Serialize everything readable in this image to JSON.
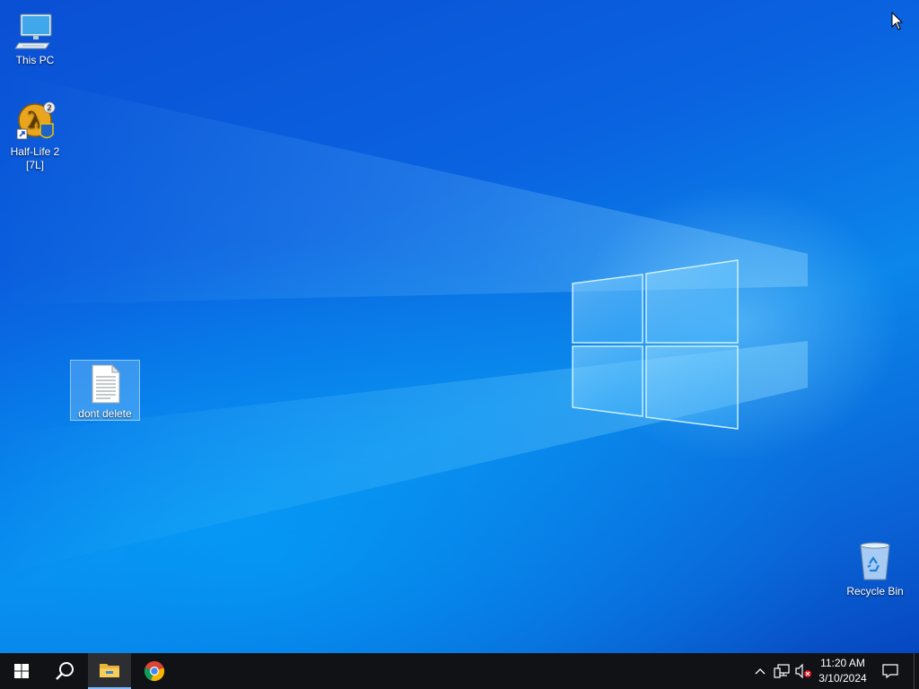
{
  "desktop": {
    "icons": [
      {
        "label": "This PC",
        "icon": "this-pc-icon"
      },
      {
        "label": "Half-Life 2\n[7L]",
        "icon": "half-life-2-shortcut-icon"
      },
      {
        "label": "dont delete",
        "icon": "text-document-icon"
      },
      {
        "label": "Recycle Bin",
        "icon": "recycle-bin-icon"
      }
    ]
  },
  "taskbar": {
    "pinned": [
      {
        "name": "Start",
        "icon": "windows-start-icon"
      },
      {
        "name": "Search",
        "icon": "search-icon"
      },
      {
        "name": "File Explorer",
        "icon": "folder-icon",
        "active": true
      },
      {
        "name": "Google Chrome",
        "icon": "chrome-icon"
      }
    ],
    "tray": {
      "icons": [
        "chevron-up-icon",
        "network-icon",
        "volume-muted-icon",
        "notification-icon"
      ]
    },
    "clock": {
      "time": "11:20 AM",
      "date": "3/10/2024"
    }
  },
  "colors": {
    "taskbar": "#101216",
    "accent": "#7ab8ff",
    "wallpaper_primary": "#0a63e0"
  }
}
